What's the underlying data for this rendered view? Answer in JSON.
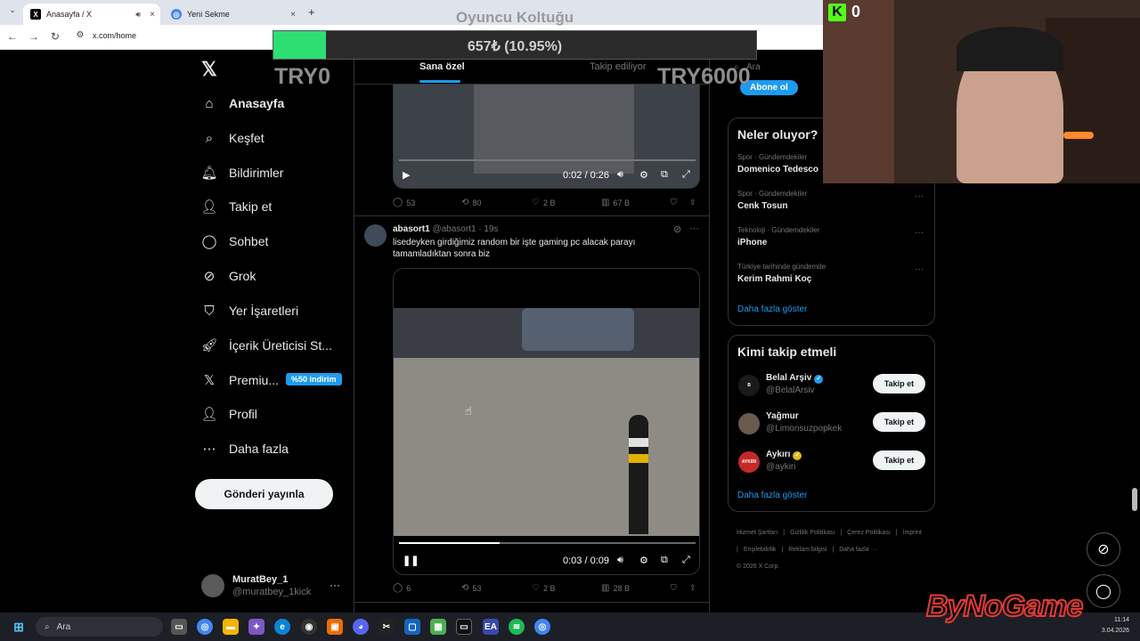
{
  "browser": {
    "tabs": [
      {
        "label": "Anasayfa / X",
        "active": true,
        "icon": "x-icon"
      },
      {
        "label": "Yeni Sekme",
        "active": false,
        "icon": "chrome-icon"
      }
    ],
    "url": "x.com/home"
  },
  "overlay": {
    "title": "Oyuncu Koltuğu",
    "progress_text": "657₺ (10.95%)",
    "progress_fraction": 0.1095,
    "left_label": "TRY0",
    "right_label": "TRY6000",
    "fill_color": "#2ddf72"
  },
  "sidebar": {
    "items": [
      {
        "label": "Anasayfa",
        "icon": "home-icon",
        "glyph": "⌂",
        "active": true
      },
      {
        "label": "Keşfet",
        "icon": "search-icon",
        "glyph": "⌕"
      },
      {
        "label": "Bildirimler",
        "icon": "bell-icon",
        "glyph": "🔔︎"
      },
      {
        "label": "Takip et",
        "icon": "person-add-icon",
        "glyph": "👤︎"
      },
      {
        "label": "Sohbet",
        "icon": "chat-icon",
        "glyph": "◯"
      },
      {
        "label": "Grok",
        "icon": "grok-icon",
        "glyph": "⊘"
      },
      {
        "label": "Yer İşaretleri",
        "icon": "bookmark-icon",
        "glyph": "⛉"
      },
      {
        "label": "İçerik Üreticisi St...",
        "icon": "rocket-icon",
        "glyph": "🚀︎"
      },
      {
        "label": "Premiu...",
        "icon": "x-premium-icon",
        "glyph": "𝕏"
      },
      {
        "label": "Profil",
        "icon": "profile-icon",
        "glyph": "👤︎"
      },
      {
        "label": "Daha fazla",
        "icon": "more-circle-icon",
        "glyph": "⋯"
      }
    ],
    "premium_badge": "%50 indirim",
    "post_button": "Gönderi yayınla",
    "user": {
      "name": "MuratBey_1",
      "handle": "@muratbey_1kick"
    }
  },
  "timeline": {
    "tabs": [
      "Sana özel",
      "Takip ediliyor"
    ],
    "post1": {
      "video_time": "0:02 / 0:26",
      "actions": {
        "replies": "53",
        "reposts": "80",
        "likes": "2 B",
        "views": "67 B"
      }
    },
    "post2": {
      "name": "abasort1",
      "handle": "@abasort1",
      "time": "· 19s",
      "text": "lisedeyken girdiğimiz random bir işte gaming pc alacak parayı tamamladıktan sonra biz",
      "video_time": "0:03 / 0:09",
      "progress_fraction": 0.34,
      "actions": {
        "replies": "6",
        "reposts": "53",
        "likes": "2 B",
        "views": "28 B"
      }
    }
  },
  "right": {
    "search_placeholder": "Ara",
    "subscribe": "Abone ol",
    "trends_title": "Neler oluyor?",
    "trends": [
      {
        "category": "Spor · Gündemdekiler",
        "name": "Domenico Tedesco"
      },
      {
        "category": "Spor · Gündemdekiler",
        "name": "Cenk Tosun"
      },
      {
        "category": "Teknoloji · Gündemdekiler",
        "name": "iPhone"
      },
      {
        "category": "Türkiye tarihinde gündemde",
        "name": "Kerim Rahmi Koç"
      }
    ],
    "show_more": "Daha fazla göster",
    "who_title": "Kimi takip etmeli",
    "who": [
      {
        "name": "Belal Arşiv",
        "handle": "@BelalArsiv",
        "verified": "blue",
        "avatar_color": "#1a1a1a",
        "avatar_text": "B"
      },
      {
        "name": "Yağmur",
        "handle": "@Limonsuzpopkek",
        "verified": "none",
        "avatar_color": "#6b5a4e",
        "avatar_text": ""
      },
      {
        "name": "Aykırı",
        "handle": "@aykiri",
        "verified": "gold",
        "avatar_color": "#c62828",
        "avatar_text": "AYKIRI"
      }
    ],
    "follow_label": "Takip et",
    "footer": [
      "Hizmet Şartları",
      "|",
      "Gizlilik Politikası",
      "|",
      "Çerez Politikası",
      "|",
      "İmprint",
      "|",
      "Erişilebilirlik",
      "|",
      "Reklam bilgisi",
      "|",
      "Daha fazla ···",
      "© 2026 X Corp."
    ]
  },
  "stream": {
    "kick_count": "0",
    "brand": "ByNoGame"
  },
  "taskbar": {
    "search_placeholder": "Ara",
    "time": "11:14",
    "date": "3.04.2026"
  }
}
